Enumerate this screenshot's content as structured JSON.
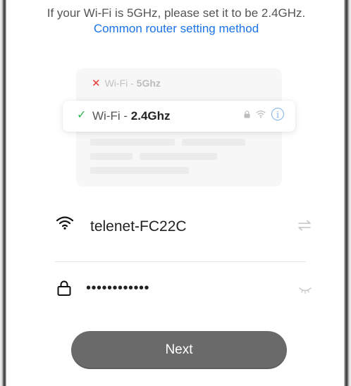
{
  "hint": {
    "text": "If your Wi-Fi is 5GHz, please set it to be 2.4GHz.",
    "link": "Common router setting method"
  },
  "illustration": {
    "wifi5": {
      "prefix": "Wi-Fi - ",
      "band": "5Ghz",
      "mark": "✕"
    },
    "wifi24": {
      "prefix": "Wi-Fi - ",
      "band": "2.4Ghz",
      "mark": "✓"
    }
  },
  "network": {
    "ssid": "telenet-FC22C",
    "password": "••••••••••••"
  },
  "actions": {
    "next_label": "Next"
  },
  "colors": {
    "link": "#1a73e8",
    "check": "#2db84d",
    "cross": "#e53935",
    "button": "#6a6a6a"
  },
  "icons": [
    "wifi-icon",
    "switch-network-icon",
    "lock-icon",
    "eye-icon",
    "info-icon",
    "check-icon",
    "close-icon"
  ]
}
